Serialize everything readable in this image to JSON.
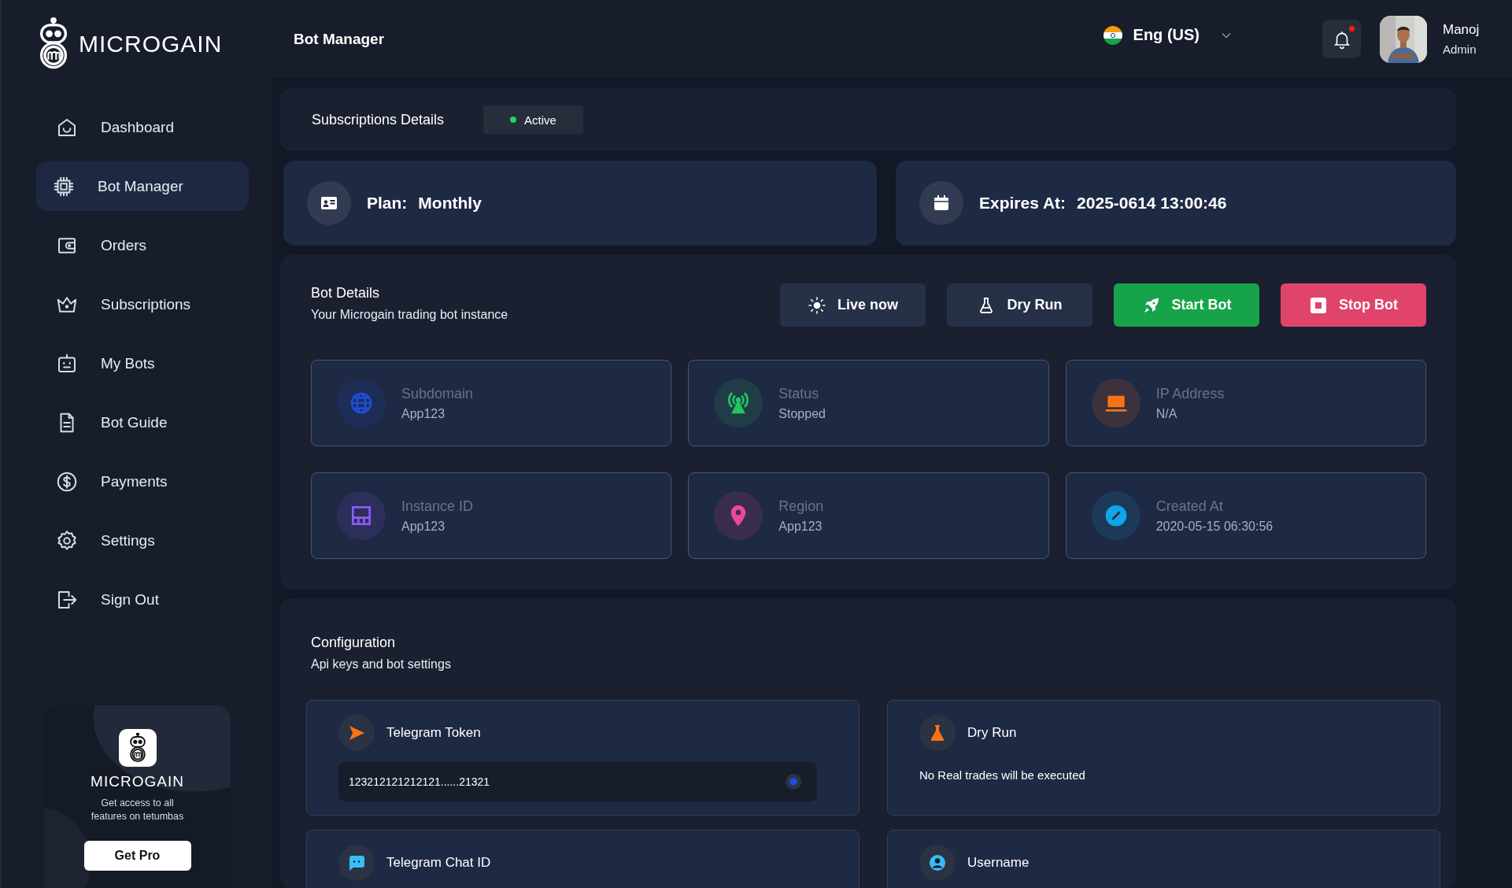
{
  "brand": {
    "name": "MICROGAIN"
  },
  "header": {
    "title": "Bot Manager",
    "language": "Eng (US)",
    "notification_unread": true,
    "user": {
      "name": "Manoj",
      "role": "Admin"
    }
  },
  "sidebar": {
    "items": [
      {
        "label": "Dashboard",
        "kind": "home",
        "selected": false
      },
      {
        "label": "Bot Manager",
        "kind": "chip",
        "selected": true
      },
      {
        "label": "Orders",
        "kind": "wallet",
        "selected": false
      },
      {
        "label": "Subscriptions",
        "kind": "crown",
        "selected": false
      },
      {
        "label": "My Bots",
        "kind": "bot",
        "selected": false
      },
      {
        "label": "Bot Guide",
        "kind": "doc",
        "selected": false
      },
      {
        "label": "Payments",
        "kind": "dollar",
        "selected": false
      },
      {
        "label": "Settings",
        "kind": "gear",
        "selected": false
      },
      {
        "label": "Sign Out",
        "kind": "signout",
        "selected": false
      }
    ],
    "promo": {
      "brand": "MICROGAIN",
      "text": "Get access to all features on tetumbas",
      "button": "Get Pro"
    }
  },
  "subscription": {
    "title": "Subscriptions Details",
    "status": "Active",
    "active": true,
    "plan": {
      "label": "Plan:",
      "value": "Monthly"
    },
    "expires": {
      "label": "Expires At:",
      "value": "2025-0614 13:00:46"
    }
  },
  "bot_details": {
    "title": "Bot Details",
    "subtitle": "Your Microgain trading bot  instance",
    "actions": [
      {
        "label": "Live now",
        "kind": "live"
      },
      {
        "label": "Dry Run",
        "kind": "dry"
      },
      {
        "label": "Start Bot",
        "kind": "start"
      },
      {
        "label": "Stop Bot",
        "kind": "stop"
      }
    ],
    "fields": [
      {
        "label": "Subdomain",
        "value": "App123",
        "kind": "globe",
        "color": "#1d4ed8"
      },
      {
        "label": "Status",
        "value": "Stopped",
        "kind": "signal",
        "color": "#22c55e"
      },
      {
        "label": "IP Address",
        "value": "N/A",
        "kind": "laptop",
        "color": "#f97316"
      },
      {
        "label": "Instance ID",
        "value": "App123",
        "kind": "panel",
        "color": "#8b5cf6"
      },
      {
        "label": "Region",
        "value": "App123",
        "kind": "pin",
        "color": "#ec4899"
      },
      {
        "label": "Created At",
        "value": "2020-05-15  06:30:56",
        "kind": "gauge",
        "color": "#0ea5e9"
      }
    ]
  },
  "configuration": {
    "title": "Configuration",
    "subtitle": "Api keys and bot settings",
    "cards": [
      {
        "kind": "token",
        "title": "Telegram Token",
        "value": "123212121212121......21321"
      },
      {
        "kind": "note",
        "title": "Dry Run",
        "note": "No Real trades will be executed"
      },
      {
        "kind": "chat",
        "title": "Telegram Chat ID"
      },
      {
        "kind": "user",
        "title": "Username"
      }
    ]
  }
}
